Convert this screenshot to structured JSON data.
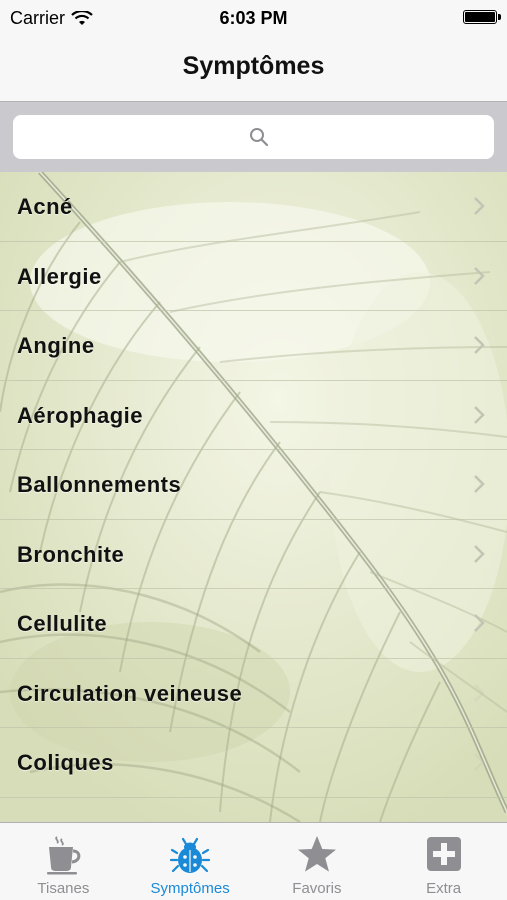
{
  "status_bar": {
    "carrier": "Carrier",
    "time": "6:03 PM",
    "wifi_icon": "wifi-icon",
    "battery_icon": "battery-icon"
  },
  "nav_bar": {
    "title": "Symptômes"
  },
  "search": {
    "placeholder": "",
    "icon": "search-icon"
  },
  "symptoms": [
    {
      "label": "Acné",
      "has_disclosure": true
    },
    {
      "label": "Allergie",
      "has_disclosure": true
    },
    {
      "label": "Angine",
      "has_disclosure": true
    },
    {
      "label": "Aérophagie",
      "has_disclosure": true
    },
    {
      "label": "Ballonnements",
      "has_disclosure": true
    },
    {
      "label": "Bronchite",
      "has_disclosure": true
    },
    {
      "label": "Cellulite",
      "has_disclosure": true
    },
    {
      "label": "Circulation veineuse",
      "has_disclosure": false
    },
    {
      "label": "Coliques",
      "has_disclosure": false
    }
  ],
  "tab_bar": {
    "tabs": [
      {
        "label": "Tisanes",
        "icon": "teacup-icon",
        "active": false
      },
      {
        "label": "Symptômes",
        "icon": "bug-icon",
        "active": true
      },
      {
        "label": "Favoris",
        "icon": "star-icon",
        "active": false
      },
      {
        "label": "Extra",
        "icon": "plus-icon",
        "active": false
      }
    ]
  },
  "colors": {
    "accent": "#1a8ad8",
    "inactive_tab": "#8e8e93",
    "list_background": "#e3e8cc"
  }
}
